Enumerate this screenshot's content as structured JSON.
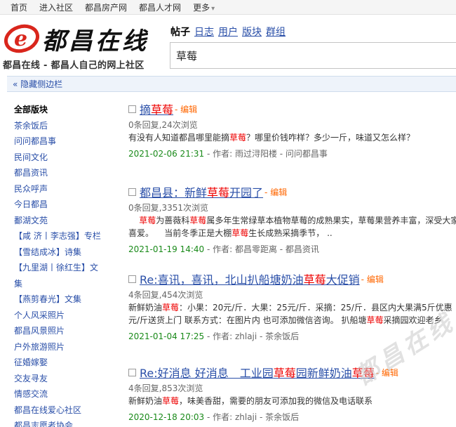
{
  "topnav": {
    "items": [
      "首页",
      "进入社区",
      "都昌房产网",
      "都昌人才网"
    ],
    "more": "更多"
  },
  "logo": {
    "title": "都昌在线",
    "slogan": "都昌在线 - 都昌人自己的网上社区"
  },
  "search": {
    "types": [
      "帖子",
      "日志",
      "用户",
      "版块",
      "群组"
    ],
    "value": "草莓"
  },
  "sidebar_toggle": "« 隐藏侧边栏",
  "sidebar": {
    "items": [
      "全部版块",
      "茶余饭后",
      "问问都昌事",
      "民间文化",
      "都昌资讯",
      "民众呼声",
      "今日都昌",
      "鄱湖文苑",
      "【咸 济丨李志强】专栏",
      "【雪结成冰】诗集",
      "【九里湖丨徐红生】文",
      "集",
      "【燕剪春光】文集",
      "个人风采照片",
      "都昌风景照片",
      "户外旅游照片",
      "征婚嫁娶",
      "交友寻友",
      "情感交流",
      "都昌在线爱心社区",
      "都昌志愿者协会"
    ]
  },
  "results": [
    {
      "title_pre": "摘",
      "title_kw": "草莓",
      "title_post": "",
      "title_kw2": "",
      "title_post2": "",
      "edit": " - 编辑",
      "stats": "0条回复,24次浏览",
      "snippet1_a": "有没有人知道都昌哪里能摘",
      "snippet1_kw": "草莓",
      "snippet1_b": "？哪里价钱咋样？多少一斤，味道又怎么样？",
      "snippet1_kw2": "",
      "snippet1_c": "",
      "snippet2_a": "",
      "snippet2_kw": "",
      "snippet2_b": "",
      "date": "2021-02-06 21:31",
      "meta": " - 作者: 雨过浔阳楼 - 问问都昌事"
    },
    {
      "title_pre": "都昌县：新鲜",
      "title_kw": "草莓",
      "title_post": "开园了",
      "title_kw2": "",
      "title_post2": "",
      "edit": " - 编辑",
      "stats": "0条回复,3351次浏览",
      "snippet1_a": "    ",
      "snippet1_kw": "草莓",
      "snippet1_b": "为蔷薇科",
      "snippet1_kw2": "草莓",
      "snippet1_c": "属多年生常绿草本植物草莓的成熟果实，草莓果营养丰富，深受大家",
      "snippet2_a": "喜爱。    当前冬季正是大棚",
      "snippet2_kw": "草莓",
      "snippet2_b": "生长成熟采摘季节，  ..",
      "date": "2021-01-19 14:40",
      "meta": " - 作者: 都昌零距离 - 都昌资讯"
    },
    {
      "title_pre": "Re:喜讯，喜讯，北山扒船塘奶油",
      "title_kw": "草莓",
      "title_post": "大促销",
      "title_kw2": "",
      "title_post2": "",
      "edit": " - 编辑",
      "stats": "4条回复,454次浏览",
      "snippet1_a": "新鲜奶油",
      "snippet1_kw": "草莓",
      "snippet1_b": "：小果：20元/斤．大果：25元/斤．采摘：25/斤．县区内大果满5斤优惠",
      "snippet1_kw2": "",
      "snippet1_c": "",
      "snippet2_a": "元/斤送货上门 联系方式：在图片内 也可添加微信咨询。 扒船塘",
      "snippet2_kw": "草莓",
      "snippet2_b": "采摘园欢迎老乡",
      "date": "2021-01-04 17:25",
      "meta": " - 作者: zhlaji - 茶余饭后"
    },
    {
      "title_pre": "Re:好消息 好消息　工业园",
      "title_kw": "草莓",
      "title_post": "园新鲜奶油",
      "title_kw2": "草莓",
      "title_post2": "",
      "edit": " - 编辑",
      "stats": "4条回复,853次浏览",
      "snippet1_a": "新鲜奶油",
      "snippet1_kw": "草莓",
      "snippet1_b": "，味美香甜，需要的朋友可添加我的微信及电话联系",
      "snippet1_kw2": "",
      "snippet1_c": "",
      "snippet2_a": "",
      "snippet2_kw": "",
      "snippet2_b": "",
      "date": "2020-12-18 20:03",
      "meta": " - 作者: zhlaji - 茶余饭后"
    }
  ],
  "watermark": "都昌在线",
  "colors": {
    "link": "#2a4fa8",
    "highlight": "#e00000",
    "edit": "#ff6600",
    "date": "#1a8a1a",
    "logo_accent": "#d9261c"
  }
}
